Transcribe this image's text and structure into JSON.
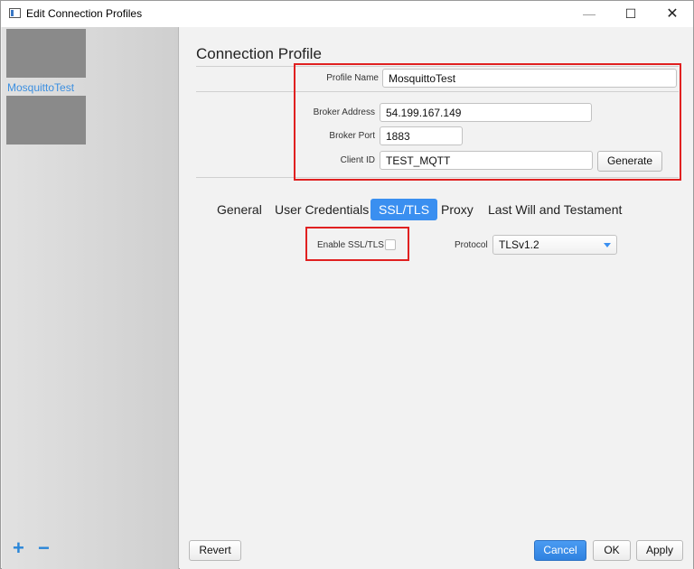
{
  "window": {
    "title": "Edit Connection Profiles",
    "min_label": "—",
    "max_label": "☐",
    "close_label": "✕"
  },
  "sidebar": {
    "items": [
      {
        "label": "MosquittoTest",
        "selected": true
      },
      {
        "label": ""
      }
    ],
    "add_label": "+",
    "remove_label": "−"
  },
  "main": {
    "title": "Connection Profile",
    "fields": {
      "profile_name": {
        "label": "Profile Name",
        "value": "MosquittoTest"
      },
      "broker_address": {
        "label": "Broker Address",
        "value": "54.199.167.149"
      },
      "broker_port": {
        "label": "Broker Port",
        "value": "1883"
      },
      "client_id": {
        "label": "Client ID",
        "value": "TEST_MQTT"
      }
    },
    "generate_label": "Generate",
    "tabs": [
      {
        "label": "General",
        "active": false
      },
      {
        "label": "User Credentials",
        "active": false
      },
      {
        "label": "SSL/TLS",
        "active": true
      },
      {
        "label": "Proxy",
        "active": false
      },
      {
        "label": "Last Will and Testament",
        "active": false
      }
    ],
    "ssl": {
      "enable_label": "Enable SSL/TLS",
      "enabled": false,
      "protocol_label": "Protocol",
      "protocol_value": "TLSv1.2"
    }
  },
  "footer": {
    "revert_label": "Revert",
    "cancel_label": "Cancel",
    "ok_label": "OK",
    "apply_label": "Apply"
  },
  "colors": {
    "accent": "#3a8ff0",
    "highlight_border": "#e02020",
    "sidebar_link": "#3c8fe0"
  }
}
